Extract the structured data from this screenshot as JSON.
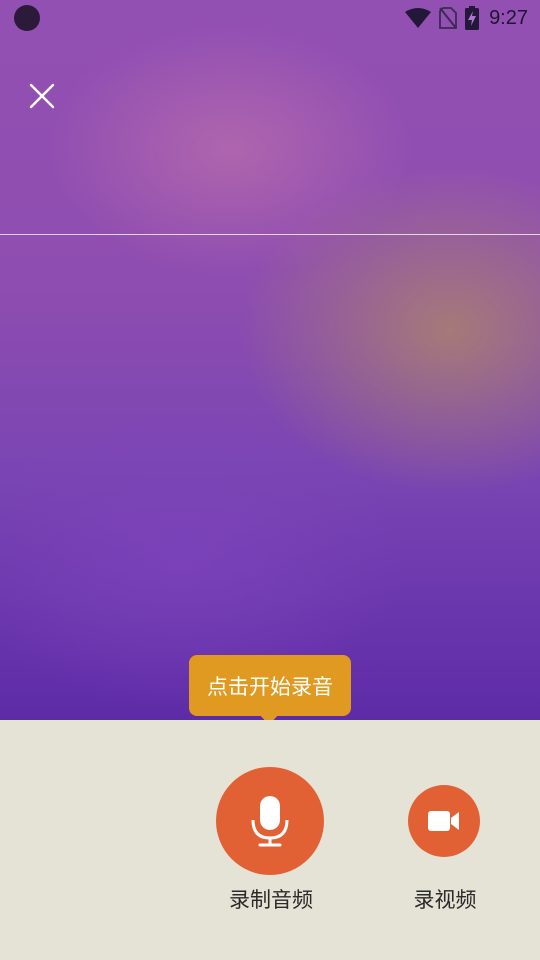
{
  "status_bar": {
    "time": "9:27",
    "icons": [
      "wifi-icon",
      "no-sim-icon",
      "battery-charging-icon"
    ]
  },
  "close": {
    "icon": "close-icon"
  },
  "tooltip": {
    "text": "点击开始录音"
  },
  "record_audio": {
    "icon": "microphone-icon",
    "label": "录制音频"
  },
  "record_video": {
    "icon": "video-camera-icon",
    "label": "录视频"
  },
  "colors": {
    "accent": "#e16134",
    "tooltip": "#e09a22",
    "panel": "#e5e3d5"
  }
}
